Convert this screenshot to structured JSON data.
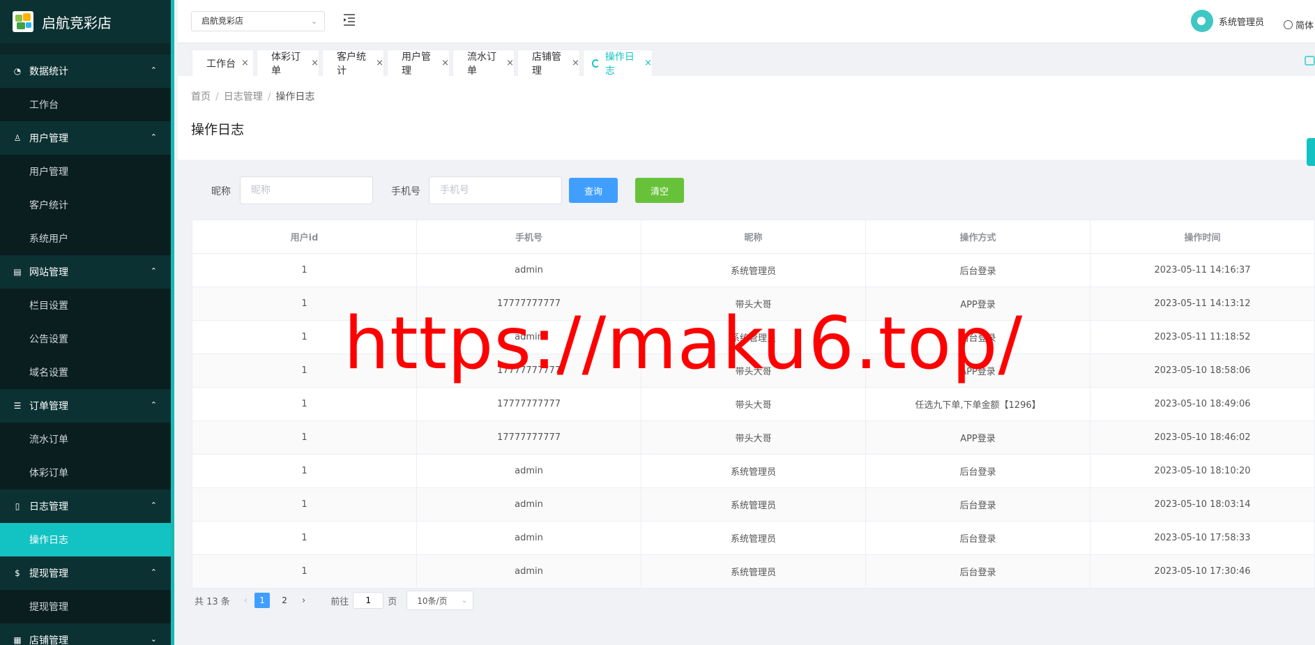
{
  "app": {
    "name": "启航竞彩店",
    "shop_selector": "启航竞彩店",
    "user_name": "系统管理员",
    "language": "简体"
  },
  "sidebar": {
    "groups": [
      {
        "label": "数据统计",
        "icon": "dashboard-icon",
        "items": [
          "工作台"
        ]
      },
      {
        "label": "用户管理",
        "icon": "user-icon",
        "items": [
          "用户管理",
          "客户统计",
          "系统用户"
        ]
      },
      {
        "label": "网站管理",
        "icon": "document-icon",
        "items": [
          "栏目设置",
          "公告设置",
          "域名设置"
        ]
      },
      {
        "label": "订单管理",
        "icon": "list-icon",
        "items": [
          "流水订单",
          "体彩订单"
        ]
      },
      {
        "label": "日志管理",
        "icon": "book-icon",
        "items": [
          "操作日志"
        ]
      },
      {
        "label": "提现管理",
        "icon": "dollar-icon",
        "items": [
          "提现管理"
        ]
      },
      {
        "label": "店铺管理",
        "icon": "shop-icon",
        "items": []
      }
    ]
  },
  "tabs": [
    "工作台",
    "体彩订单",
    "客户统计",
    "用户管理",
    "流水订单",
    "店铺管理",
    "操作日志"
  ],
  "breadcrumb": [
    "首页",
    "日志管理",
    "操作日志"
  ],
  "page_title": "操作日志",
  "search": {
    "nickname_label": "昵称",
    "nickname_placeholder": "昵称",
    "phone_label": "手机号",
    "phone_placeholder": "手机号",
    "query_button": "查询",
    "clear_button": "清空"
  },
  "table": {
    "headers": [
      "用户id",
      "手机号",
      "昵称",
      "操作方式",
      "操作时间"
    ],
    "rows": [
      [
        "1",
        "admin",
        "系统管理员",
        "后台登录",
        "2023-05-11 14:16:37"
      ],
      [
        "1",
        "17777777777",
        "带头大哥",
        "APP登录",
        "2023-05-11 14:13:12"
      ],
      [
        "1",
        "admin",
        "系统管理员",
        "后台登录",
        "2023-05-11 11:18:52"
      ],
      [
        "1",
        "17777777777",
        "带头大哥",
        "APP登录",
        "2023-05-10 18:58:06"
      ],
      [
        "1",
        "17777777777",
        "带头大哥",
        "任选九下单,下单金额【1296】",
        "2023-05-10 18:49:06"
      ],
      [
        "1",
        "17777777777",
        "带头大哥",
        "APP登录",
        "2023-05-10 18:46:02"
      ],
      [
        "1",
        "admin",
        "系统管理员",
        "后台登录",
        "2023-05-10 18:10:20"
      ],
      [
        "1",
        "admin",
        "系统管理员",
        "后台登录",
        "2023-05-10 18:03:14"
      ],
      [
        "1",
        "admin",
        "系统管理员",
        "后台登录",
        "2023-05-10 17:58:33"
      ],
      [
        "1",
        "admin",
        "系统管理员",
        "后台登录",
        "2023-05-10 17:30:46"
      ]
    ]
  },
  "pagination": {
    "total_text": "共 13 条",
    "pages": [
      "1",
      "2"
    ],
    "current_page": "1",
    "goto_label": "前往",
    "page_suffix": "页",
    "goto_value": "1",
    "page_size": "10条/页"
  },
  "watermark": "https://maku6.top/",
  "colors": {
    "accent": "#13c2c2",
    "sidebar_bg": "#0d2628",
    "query": "#409eff",
    "clear": "#67c23a",
    "watermark": "#ff0000"
  }
}
